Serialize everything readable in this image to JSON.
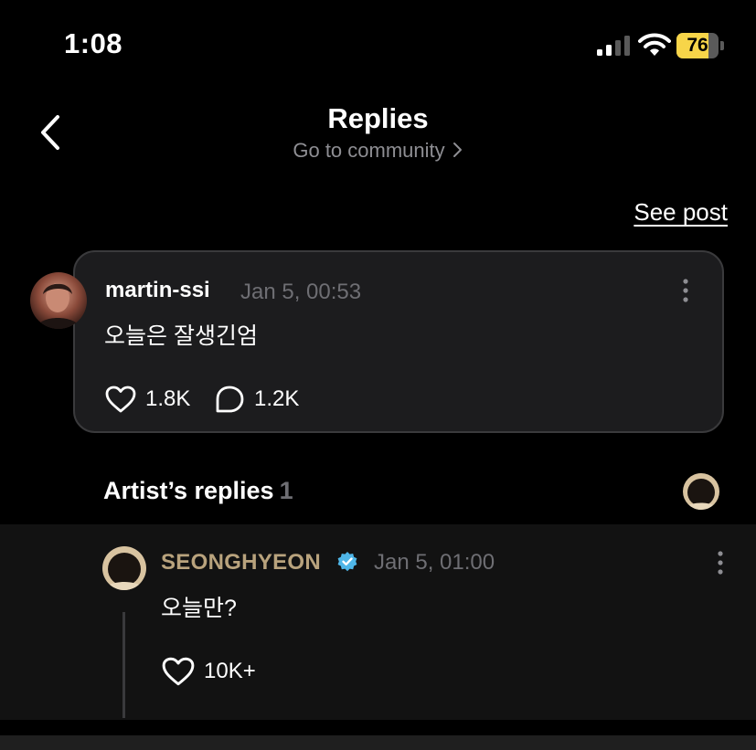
{
  "status_bar": {
    "time": "1:08",
    "battery": "76",
    "battery_level": 0.76
  },
  "header": {
    "title": "Replies",
    "community_link": "Go to community",
    "see_post": "See post"
  },
  "comment": {
    "author": "martin-ssi",
    "timestamp": "Jan 5, 00:53",
    "text": "오늘은 잘생긴엄",
    "likes": "1.8K",
    "replies": "1.2K"
  },
  "artist_replies": {
    "label": "Artist’s replies",
    "count": "1"
  },
  "reply": {
    "author": "SEONGHYEON",
    "timestamp": "Jan 5, 01:00",
    "text": "오늘만?",
    "likes": "10K+"
  },
  "colors": {
    "background": "#000000",
    "card": "#1c1c1e",
    "reply_background": "#121212",
    "artist_name": "#b9a37d",
    "verified": "#4fb6e8",
    "muted": "#6e6e73",
    "battery": "#f7d549"
  }
}
